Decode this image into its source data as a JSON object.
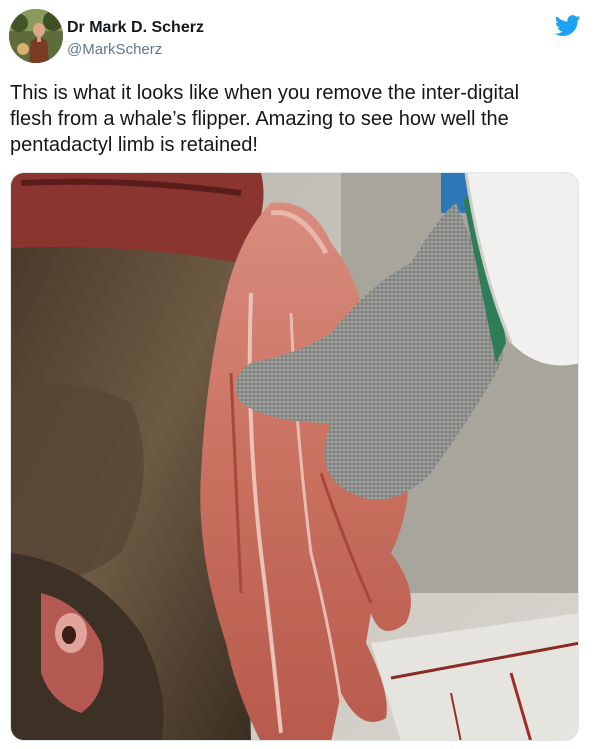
{
  "author": {
    "name": "Dr Mark D. Scherz",
    "handle": "@MarkScherz"
  },
  "tweet": {
    "text_lines": [
      "This is what it looks like when you remove the inter-digital",
      "flesh from a whale’s flipper. Amazing to see how well the",
      "pentadactyl limb is retained!"
    ]
  },
  "icons": {
    "brand": "twitter-bird-icon"
  },
  "colors": {
    "brand": "#1da1f2",
    "name": "#14171a",
    "handle": "#657786"
  }
}
